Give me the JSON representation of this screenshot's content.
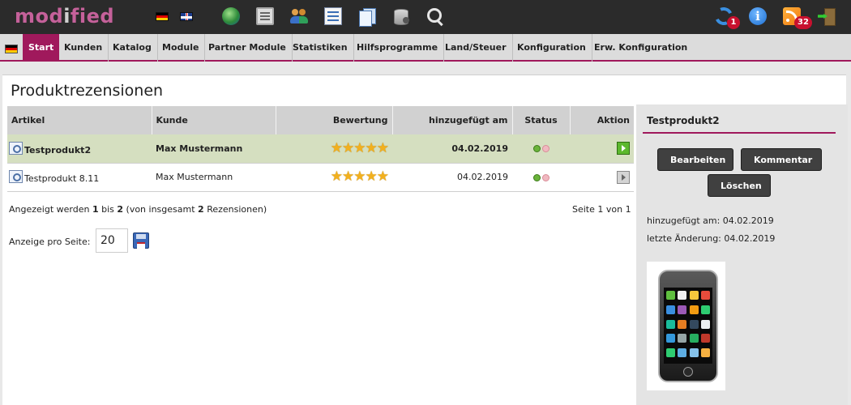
{
  "brand": {
    "logo_left": "mod",
    "logo_mid": "i",
    "logo_right": "fied"
  },
  "topbar": {
    "icons": [
      "flag-de-icon",
      "flag-uk-icon",
      "globe-icon",
      "basket-icon",
      "customers-icon",
      "list-icon",
      "documents-icon",
      "database-icon",
      "search-icon",
      "sync-icon",
      "info-icon",
      "rss-icon",
      "logout-icon"
    ],
    "sync_badge": "1",
    "rss_badge": "32",
    "info_glyph": "i"
  },
  "menu": {
    "items": [
      "Start",
      "Kunden",
      "Katalog",
      "Module",
      "Partner Module",
      "Statistiken",
      "Hilfsprogramme",
      "Land/Steuer",
      "Konfiguration",
      "Erw. Konfiguration"
    ],
    "active_index": 0
  },
  "page": {
    "title": "Produktrezensionen"
  },
  "table": {
    "headers": {
      "artikel": "Artikel",
      "kunde": "Kunde",
      "bewertung": "Bewertung",
      "date": "hinzugefügt am",
      "status": "Status",
      "aktion": "Aktion"
    },
    "rows": [
      {
        "artikel": "Testprodukt2",
        "kunde": "Max Mustermann",
        "rating": 5,
        "stars": "★★★★★",
        "date": "04.02.2019",
        "status_active": true,
        "selected": true
      },
      {
        "artikel": "Testprodukt 8.11",
        "kunde": "Max Mustermann",
        "rating": 5,
        "stars": "★★★★★",
        "date": "04.02.2019",
        "status_active": true,
        "selected": false
      }
    ]
  },
  "footer": {
    "summary_pre": "Angezeigt werden ",
    "summary_from": "1",
    "summary_mid1": " bis ",
    "summary_to": "2",
    "summary_mid2": " (von insgesamt ",
    "summary_total": "2",
    "summary_post": " Rezensionen)",
    "page_info": "Seite 1 von 1",
    "per_page_label": "Anzeige pro Seite:",
    "per_page_value": "20"
  },
  "sidebar": {
    "title": "Testprodukt2",
    "buttons": {
      "edit": "Bearbeiten",
      "comment": "Kommentar",
      "delete": "Löschen"
    },
    "added": "hinzugefügt am: 04.02.2019",
    "changed": "letzte Änderung: 04.02.2019"
  },
  "colors": {
    "brand": "#c5619a",
    "accent": "#a0195c",
    "topbar": "#2b2b2b",
    "selected_row": "#d5dfc0",
    "button": "#404040"
  }
}
